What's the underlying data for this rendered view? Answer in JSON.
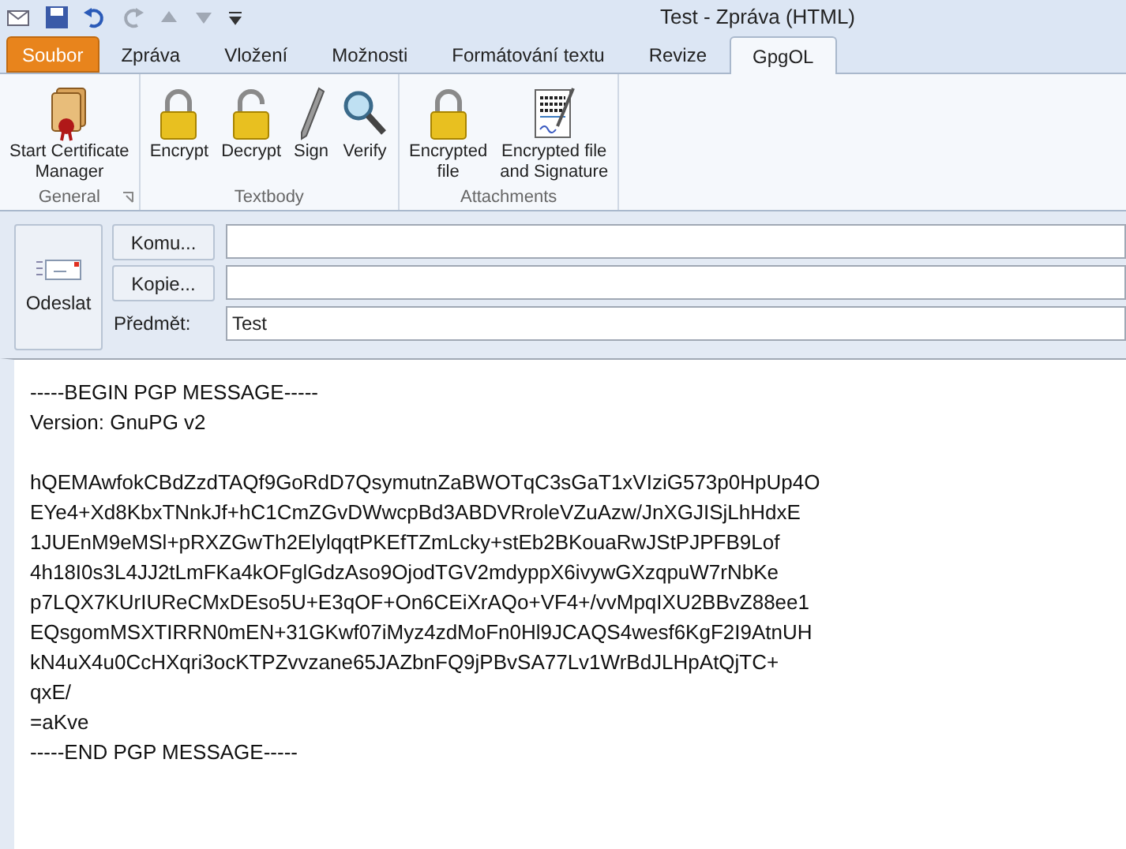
{
  "window": {
    "title": "Test  -  Zpráva (HTML)"
  },
  "tabs": [
    {
      "label": "Soubor",
      "kind": "file",
      "selected": false
    },
    {
      "label": "Zpráva",
      "kind": "tab",
      "selected": false
    },
    {
      "label": "Vložení",
      "kind": "tab",
      "selected": false
    },
    {
      "label": "Možnosti",
      "kind": "tab",
      "selected": false
    },
    {
      "label": "Formátování textu",
      "kind": "tab",
      "selected": false
    },
    {
      "label": "Revize",
      "kind": "tab",
      "selected": false
    },
    {
      "label": "GpgOL",
      "kind": "tab",
      "selected": true
    }
  ],
  "ribbon_groups": [
    {
      "label": "General",
      "launcher": true,
      "buttons": [
        {
          "label": [
            "Start Certificate",
            "Manager"
          ],
          "kind": "certificate"
        }
      ]
    },
    {
      "label": "Textbody",
      "launcher": false,
      "buttons": [
        {
          "label": [
            "Encrypt"
          ],
          "kind": "lock"
        },
        {
          "label": [
            "Decrypt"
          ],
          "kind": "unlock"
        },
        {
          "label": [
            "Sign"
          ],
          "kind": "pen"
        },
        {
          "label": [
            "Verify"
          ],
          "kind": "magnifier"
        }
      ]
    },
    {
      "label": "Attachments",
      "launcher": false,
      "buttons": [
        {
          "label": [
            "Encrypted",
            "file"
          ],
          "kind": "lock"
        },
        {
          "label": [
            "Encrypted file",
            "and Signature"
          ],
          "kind": "document"
        }
      ]
    }
  ],
  "compose": {
    "send": "Odeslat",
    "to_button": "Komu...",
    "cc_button": "Kopie...",
    "subject_label": "Předmět:",
    "subject_value": "Test"
  },
  "message": {
    "header": [
      "-----BEGIN PGP MESSAGE-----",
      "Version: GnuPG v2"
    ],
    "body": [
      "hQEMAwfokCBdZzdTAQf9GoRdD7QsymutnZaBWOTqC3sGaT1xVIziG573p0HpUp4O",
      "EYe4+Xd8KbxTNnkJf+hC1CmZGvDWwcpBd3ABDVRroleVZuAzw/JnXGJISjLhHdxE",
      "1JUEnM9eMSl+pRXZGwTh2ElylqqtPKEfTZmLcky+stEb2BKouaRwJStPJPFB9Lof",
      "4h18I0s3L4JJ2tLmFKa4kOFglGdzAso9OjodTGV2mdyppX6ivywGXzqpuW7rNbKe",
      "p7LQX7KUrIUReCMxDEso5U+E3qOF+On6CEiXrAQo+VF4+/vvMpqIXU2BBvZ88ee1",
      "EQsgomMSXTIRRN0mEN+31GKwf07iMyz4zdMoFn0Hl9JCAQS4wesf6KgF2I9AtnUH",
      "kN4uX4u0CcHXqri3ocKTPZvvzane65JAZbnFQ9jPBvSA77Lv1WrBdJLHpAtQjTC+",
      "qxE/",
      "=aKve",
      "-----END PGP MESSAGE-----"
    ]
  }
}
